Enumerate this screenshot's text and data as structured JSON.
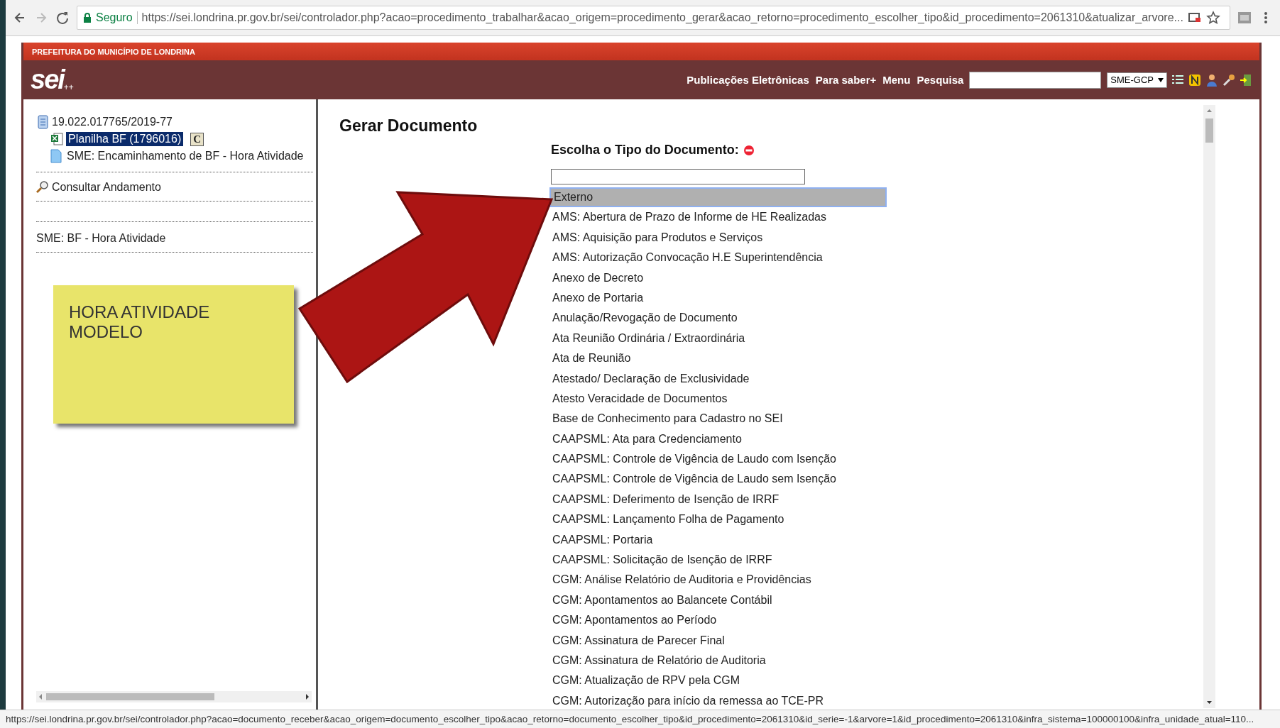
{
  "browser": {
    "secure_label": "Seguro",
    "url": "https://sei.londrina.pr.gov.br/sei/controlador.php?acao=procedimento_trabalhar&acao_origem=procedimento_gerar&acao_retorno=procedimento_escolher_tipo&id_procedimento=2061310&atualizar_arvore...",
    "status_url": "https://sei.londrina.pr.gov.br/sei/controlador.php?acao=documento_receber&acao_origem=documento_escolher_tipo&acao_retorno=documento_escolher_tipo&id_procedimento=2061310&id_serie=-1&arvore=1&id_procedimento=2061310&infra_sistema=100000100&infra_unidade_atual=110..."
  },
  "header": {
    "organization": "PREFEITURA DO MUNICÍPIO DE LONDRINA",
    "logo": "sei",
    "logo_suffix": "++",
    "nav": [
      "Publicações Eletrônicas",
      "Para saber+",
      "Menu",
      "Pesquisa"
    ],
    "unit": "SME-GCP"
  },
  "tree": {
    "process": "19.022.017765/2019-77",
    "documents": [
      {
        "label": "Planilha BF (1796016)",
        "kind": "spreadsheet",
        "selected": true,
        "badge": "C"
      },
      {
        "label": "SME: Encaminhamento de BF - Hora Atividade",
        "kind": "document",
        "selected": false
      }
    ]
  },
  "consult": "Consultar Andamento",
  "marker": "SME: BF - Hora Atividade",
  "note": "HORA ATIVIDADE MODELO",
  "main": {
    "title": "Gerar Documento",
    "prompt": "Escolha o Tipo do Documento:",
    "types": [
      {
        "label": "Externo",
        "selected": true
      },
      {
        "label": "AMS: Abertura de Prazo de Informe de HE Realizadas",
        "selected": false
      },
      {
        "label": "AMS: Aquisição para Produtos e Serviços",
        "selected": false
      },
      {
        "label": "AMS: Autorização Convocação H.E Superintendência",
        "selected": false
      },
      {
        "label": "Anexo de Decreto",
        "selected": false
      },
      {
        "label": "Anexo de Portaria",
        "selected": false
      },
      {
        "label": "Anulação/Revogação de Documento",
        "selected": false
      },
      {
        "label": "Ata Reunião Ordinária / Extraordinária",
        "selected": false
      },
      {
        "label": "Ata de Reunião",
        "selected": false
      },
      {
        "label": "Atestado/ Declaração de Exclusividade",
        "selected": false
      },
      {
        "label": "Atesto Veracidade de Documentos",
        "selected": false
      },
      {
        "label": "Base de Conhecimento para Cadastro no SEI",
        "selected": false
      },
      {
        "label": "CAAPSML: Ata para Credenciamento",
        "selected": false
      },
      {
        "label": "CAAPSML: Controle de Vigência de Laudo com Isenção",
        "selected": false
      },
      {
        "label": "CAAPSML: Controle de Vigência de Laudo sem Isenção",
        "selected": false
      },
      {
        "label": "CAAPSML: Deferimento de Isenção de IRRF",
        "selected": false
      },
      {
        "label": "CAAPSML: Lançamento Folha de Pagamento",
        "selected": false
      },
      {
        "label": "CAAPSML: Portaria",
        "selected": false
      },
      {
        "label": "CAAPSML: Solicitação de Isenção de IRRF",
        "selected": false
      },
      {
        "label": "CGM: Análise Relatório de Auditoria e Providências",
        "selected": false
      },
      {
        "label": "CGM: Apontamentos ao Balancete Contábil",
        "selected": false
      },
      {
        "label": "CGM: Apontamentos ao Período",
        "selected": false
      },
      {
        "label": "CGM: Assinatura de Parecer Final",
        "selected": false
      },
      {
        "label": "CGM: Assinatura de Relatório de Auditoria",
        "selected": false
      },
      {
        "label": "CGM: Atualização de RPV pela CGM",
        "selected": false
      },
      {
        "label": "CGM: Autorização para início da remessa ao TCE-PR",
        "selected": false
      }
    ]
  }
}
